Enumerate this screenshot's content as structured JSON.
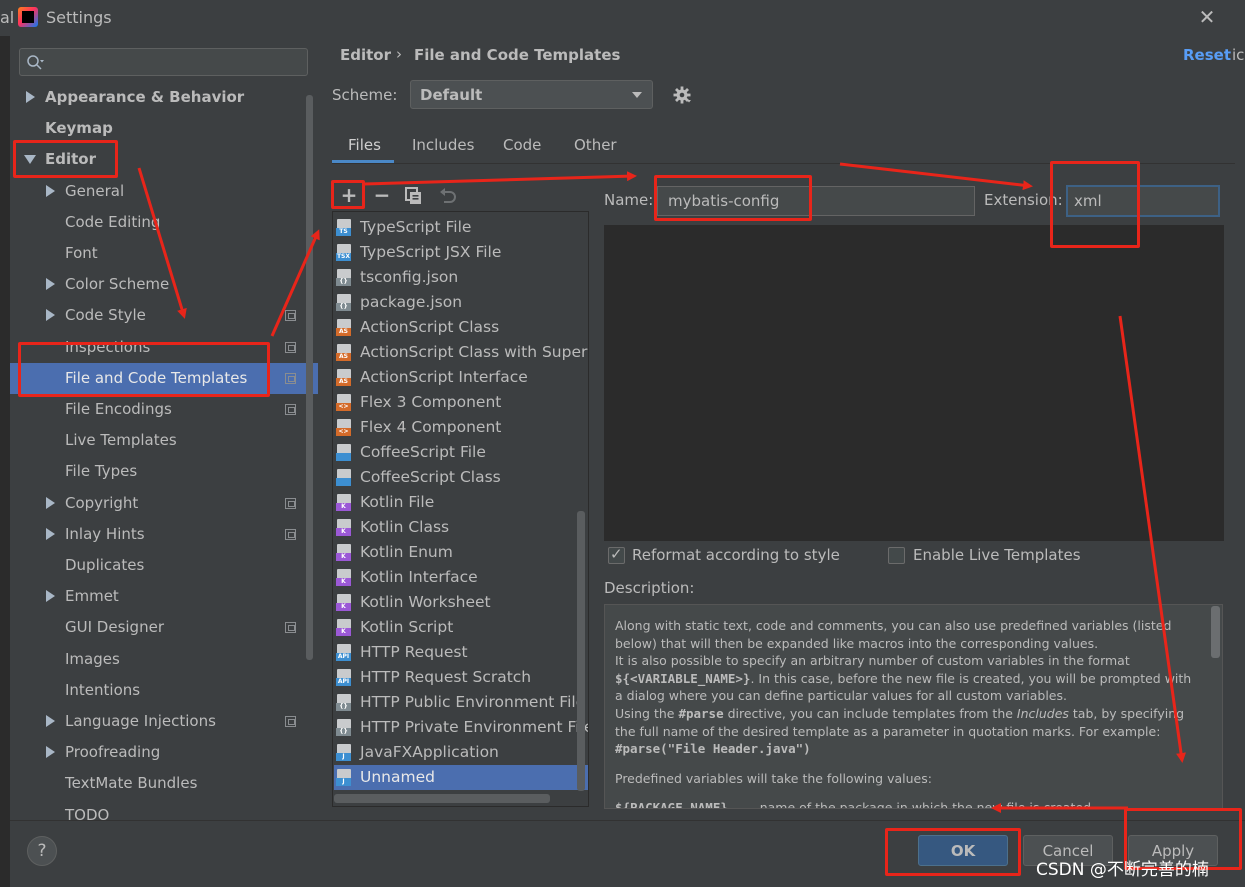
{
  "window": {
    "title": "Settings",
    "bg_left_text": "al",
    "bg_right_text": "ic"
  },
  "search": {
    "placeholder": ""
  },
  "sidebar": {
    "items": [
      {
        "label": "Appearance & Behavior",
        "bold": true,
        "expander": "collapsed",
        "indent": 0,
        "project_icon": false
      },
      {
        "label": "Keymap",
        "bold": true,
        "expander": "none",
        "indent": 0,
        "project_icon": false
      },
      {
        "label": "Editor",
        "bold": true,
        "expander": "expanded",
        "indent": 0,
        "project_icon": false
      },
      {
        "label": "General",
        "bold": false,
        "expander": "collapsed",
        "indent": 1,
        "project_icon": false
      },
      {
        "label": "Code Editing",
        "bold": false,
        "expander": "none",
        "indent": 1,
        "project_icon": false
      },
      {
        "label": "Font",
        "bold": false,
        "expander": "none",
        "indent": 1,
        "project_icon": false
      },
      {
        "label": "Color Scheme",
        "bold": false,
        "expander": "collapsed",
        "indent": 1,
        "project_icon": false
      },
      {
        "label": "Code Style",
        "bold": false,
        "expander": "collapsed",
        "indent": 1,
        "project_icon": true
      },
      {
        "label": "Inspections",
        "bold": false,
        "expander": "none",
        "indent": 1,
        "project_icon": true
      },
      {
        "label": "File and Code Templates",
        "bold": false,
        "expander": "none",
        "indent": 1,
        "project_icon": true,
        "selected": true
      },
      {
        "label": "File Encodings",
        "bold": false,
        "expander": "none",
        "indent": 1,
        "project_icon": true
      },
      {
        "label": "Live Templates",
        "bold": false,
        "expander": "none",
        "indent": 1,
        "project_icon": false
      },
      {
        "label": "File Types",
        "bold": false,
        "expander": "none",
        "indent": 1,
        "project_icon": false
      },
      {
        "label": "Copyright",
        "bold": false,
        "expander": "collapsed",
        "indent": 1,
        "project_icon": true
      },
      {
        "label": "Inlay Hints",
        "bold": false,
        "expander": "collapsed",
        "indent": 1,
        "project_icon": true
      },
      {
        "label": "Duplicates",
        "bold": false,
        "expander": "none",
        "indent": 1,
        "project_icon": false
      },
      {
        "label": "Emmet",
        "bold": false,
        "expander": "collapsed",
        "indent": 1,
        "project_icon": false
      },
      {
        "label": "GUI Designer",
        "bold": false,
        "expander": "none",
        "indent": 1,
        "project_icon": true
      },
      {
        "label": "Images",
        "bold": false,
        "expander": "none",
        "indent": 1,
        "project_icon": false
      },
      {
        "label": "Intentions",
        "bold": false,
        "expander": "none",
        "indent": 1,
        "project_icon": false
      },
      {
        "label": "Language Injections",
        "bold": false,
        "expander": "collapsed",
        "indent": 1,
        "project_icon": true
      },
      {
        "label": "Proofreading",
        "bold": false,
        "expander": "collapsed",
        "indent": 1,
        "project_icon": false
      },
      {
        "label": "TextMate Bundles",
        "bold": false,
        "expander": "none",
        "indent": 1,
        "project_icon": false
      },
      {
        "label": "TODO",
        "bold": false,
        "expander": "none",
        "indent": 1,
        "project_icon": false
      }
    ]
  },
  "header": {
    "breadcrumb": [
      "Editor",
      "File and Code Templates"
    ],
    "breadcrumb_sep": "›",
    "reset_label": "Reset"
  },
  "scheme": {
    "label": "Scheme:",
    "value": "Default"
  },
  "tabs": [
    {
      "label": "Files",
      "active": true
    },
    {
      "label": "Includes",
      "active": false
    },
    {
      "label": "Code",
      "active": false
    },
    {
      "label": "Other",
      "active": false
    }
  ],
  "toolbar": {
    "add": "+",
    "remove": "−"
  },
  "templates": [
    {
      "label": "TypeScript File",
      "tag": "TS",
      "tag_color": "#3d8fd1"
    },
    {
      "label": "TypeScript JSX File",
      "tag": "TSX",
      "tag_color": "#3d8fd1"
    },
    {
      "label": "tsconfig.json",
      "tag": "{}",
      "tag_color": "#7f8b91"
    },
    {
      "label": "package.json",
      "tag": "{}",
      "tag_color": "#7f8b91"
    },
    {
      "label": "ActionScript Class",
      "tag": "AS",
      "tag_color": "#d46b2a"
    },
    {
      "label": "ActionScript Class with Supers",
      "tag": "AS",
      "tag_color": "#d46b2a"
    },
    {
      "label": "ActionScript Interface",
      "tag": "AS",
      "tag_color": "#d46b2a"
    },
    {
      "label": "Flex 3 Component",
      "tag": "<>",
      "tag_color": "#d46b2a"
    },
    {
      "label": "Flex 4 Component",
      "tag": "<>",
      "tag_color": "#d46b2a"
    },
    {
      "label": "CoffeeScript File",
      "tag": "",
      "tag_color": "#3d8fd1"
    },
    {
      "label": "CoffeeScript Class",
      "tag": "",
      "tag_color": "#3d8fd1"
    },
    {
      "label": "Kotlin File",
      "tag": "K",
      "tag_color": "#9b59d6"
    },
    {
      "label": "Kotlin Class",
      "tag": "K",
      "tag_color": "#9b59d6"
    },
    {
      "label": "Kotlin Enum",
      "tag": "K",
      "tag_color": "#9b59d6"
    },
    {
      "label": "Kotlin Interface",
      "tag": "K",
      "tag_color": "#9b59d6"
    },
    {
      "label": "Kotlin Worksheet",
      "tag": "K",
      "tag_color": "#9b59d6"
    },
    {
      "label": "Kotlin Script",
      "tag": "K",
      "tag_color": "#9b59d6"
    },
    {
      "label": "HTTP Request",
      "tag": "API",
      "tag_color": "#3d8fd1"
    },
    {
      "label": "HTTP Request Scratch",
      "tag": "API",
      "tag_color": "#3d8fd1"
    },
    {
      "label": "HTTP Public Environment File",
      "tag": "{}",
      "tag_color": "#7f8b91"
    },
    {
      "label": "HTTP Private Environment File",
      "tag": "{}",
      "tag_color": "#7f8b91"
    },
    {
      "label": "JavaFXApplication",
      "tag": "J",
      "tag_color": "#3d8fd1"
    },
    {
      "label": "Unnamed",
      "tag": "J",
      "tag_color": "#3d8fd1",
      "selected": true
    }
  ],
  "form": {
    "name_label": "Name:",
    "name_value": "mybatis-config",
    "ext_label": "Extension:",
    "ext_value": "xml",
    "reformat_label": "Reformat according to style",
    "reformat_checked": true,
    "live_label": "Enable Live Templates",
    "live_checked": false,
    "desc_label": "Description:"
  },
  "description": {
    "p1_a": "Along with static text, code and comments, you can also use predefined variables (listed below) that will then be expanded like macros into the corresponding values.",
    "p1_b": "It is also possible to specify an arbitrary number of custom variables in the format ",
    "p1_b_code": "${<VARIABLE_NAME>}",
    "p1_c": ". In this case, before the new file is created, you will be prompted with a dialog where you can define particular values for all custom variables.",
    "p1_d": "Using the ",
    "p1_d_code": "#parse",
    "p1_e": " directive, you can include templates from the ",
    "p1_e_em": "Includes",
    "p1_f": " tab, by specifying the full name of the desired template as a parameter in quotation marks. For example:",
    "p1_g_code": "#parse(\"File Header.java\")",
    "p2": "Predefined variables will take the following values:",
    "p3_code": "${PACKAGE_NAME}",
    "p3_text": "name of the package in which the new file is created"
  },
  "buttons": {
    "help": "?",
    "ok": "OK",
    "cancel": "Cancel",
    "apply": "Apply"
  },
  "watermark": "CSDN @不断完善的楠",
  "colors": {
    "accent": "#4b6eaf",
    "annotation": "#e8251a",
    "link": "#589df6"
  }
}
